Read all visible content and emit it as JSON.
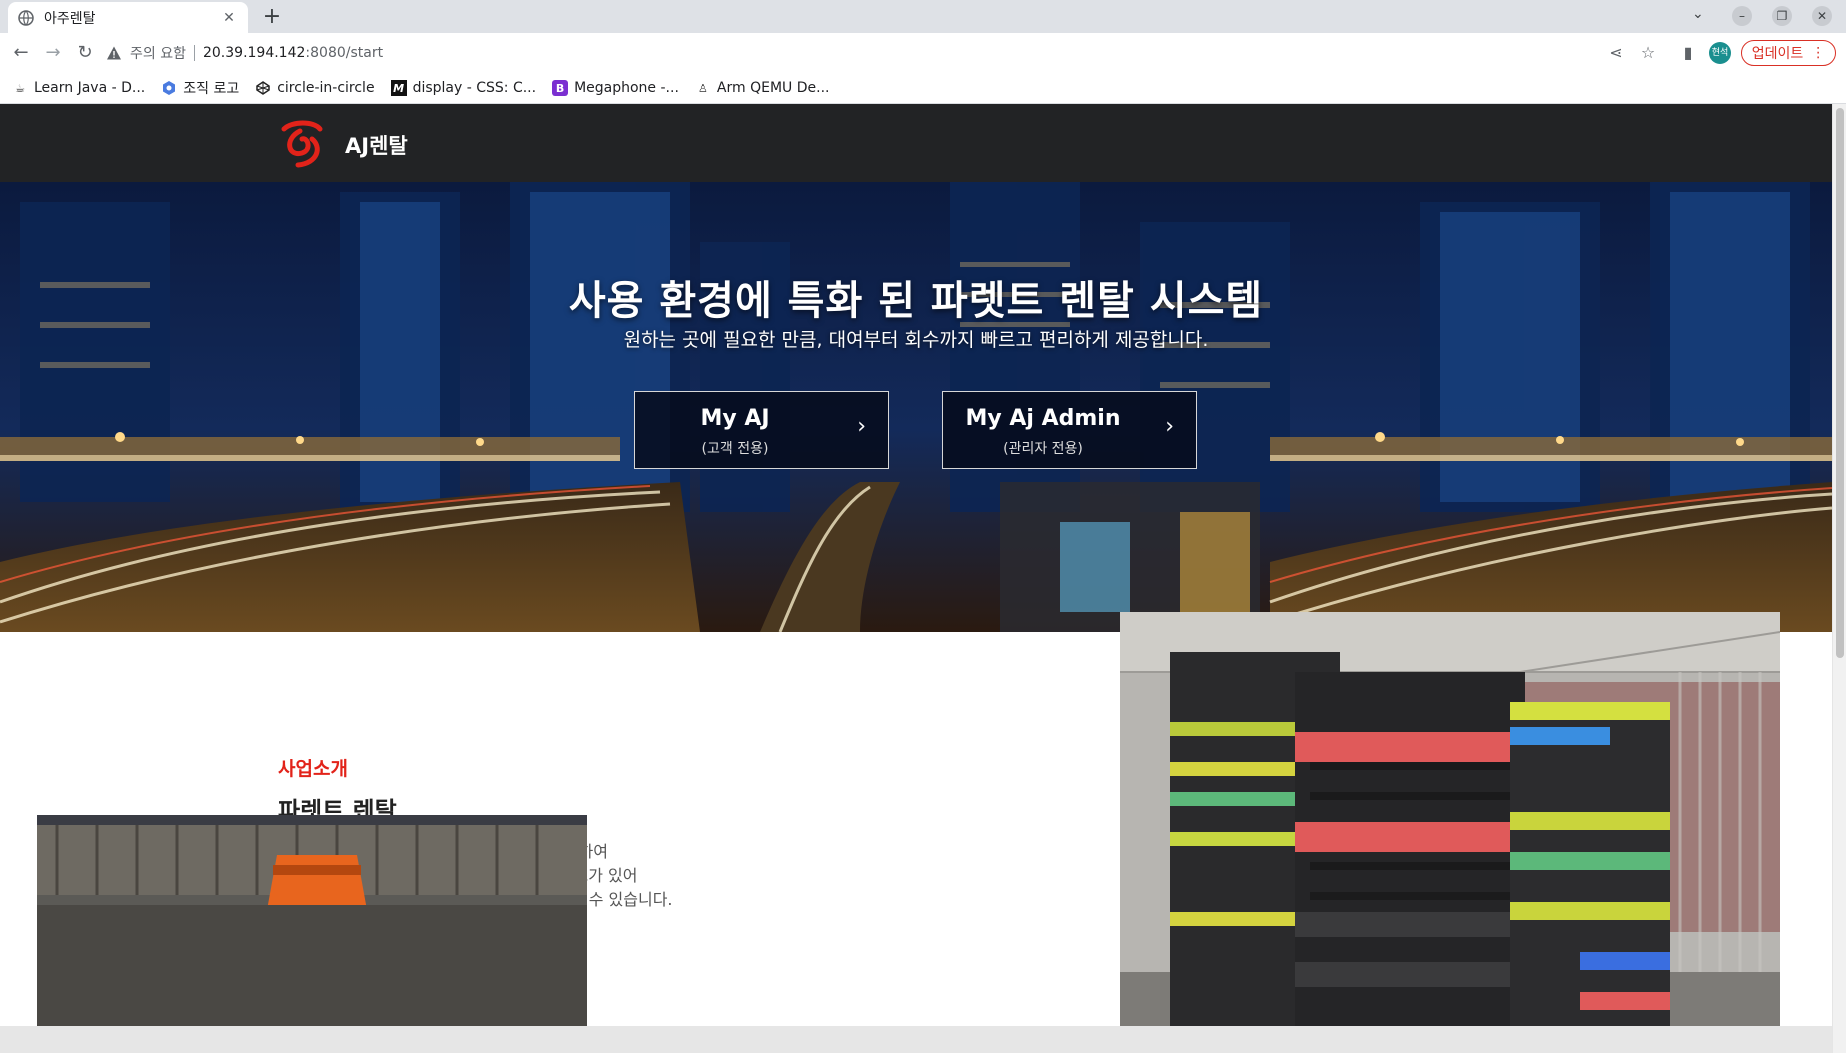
{
  "browser": {
    "tab_title": "아주렌탈",
    "new_tab_symbol": "+",
    "address": {
      "security_label": "주의 요함",
      "host": "20.39.194.142",
      "rest": ":8080/start"
    },
    "profile_label": "현석",
    "update_label": "업데이트",
    "bookmarks": [
      {
        "label": "Learn Java - D...",
        "icon": "java-icon"
      },
      {
        "label": "조직 로고",
        "icon": "org-logo-icon"
      },
      {
        "label": "circle-in-circle",
        "icon": "codepen-icon"
      },
      {
        "label": "display - CSS: C...",
        "icon": "mdn-icon"
      },
      {
        "label": "Megaphone -...",
        "icon": "megaphone-icon"
      },
      {
        "label": "Arm QEMU De...",
        "icon": "linux-icon"
      }
    ]
  },
  "site": {
    "brand_name": "AJ렌탈",
    "brand_color": "#e2231a",
    "hero": {
      "title": "사용 환경에 특화 된 파렛트 렌탈 시스템",
      "subtitle": "원하는 곳에 필요한 만큼, 대여부터 회수까지 빠르고 편리하게 제공합니다.",
      "buttons": [
        {
          "label": "My AJ",
          "sub": "(고객 전용)"
        },
        {
          "label": "My Aj Admin",
          "sub": "(관리자 전용)"
        }
      ]
    },
    "intro": {
      "label": "사업소개",
      "title": "파렛트 렌탈",
      "lines": [
        "고객이 원하는 곳에, 원하는 날짜에 미리 예약하여",
        "렌탈하는 것이 가능하며, 각 파렛트마다의 코드가 있어",
        "회수, 분실 등의 현황을 쉽게 파악하고 요청 할 수 있습니다."
      ]
    }
  }
}
